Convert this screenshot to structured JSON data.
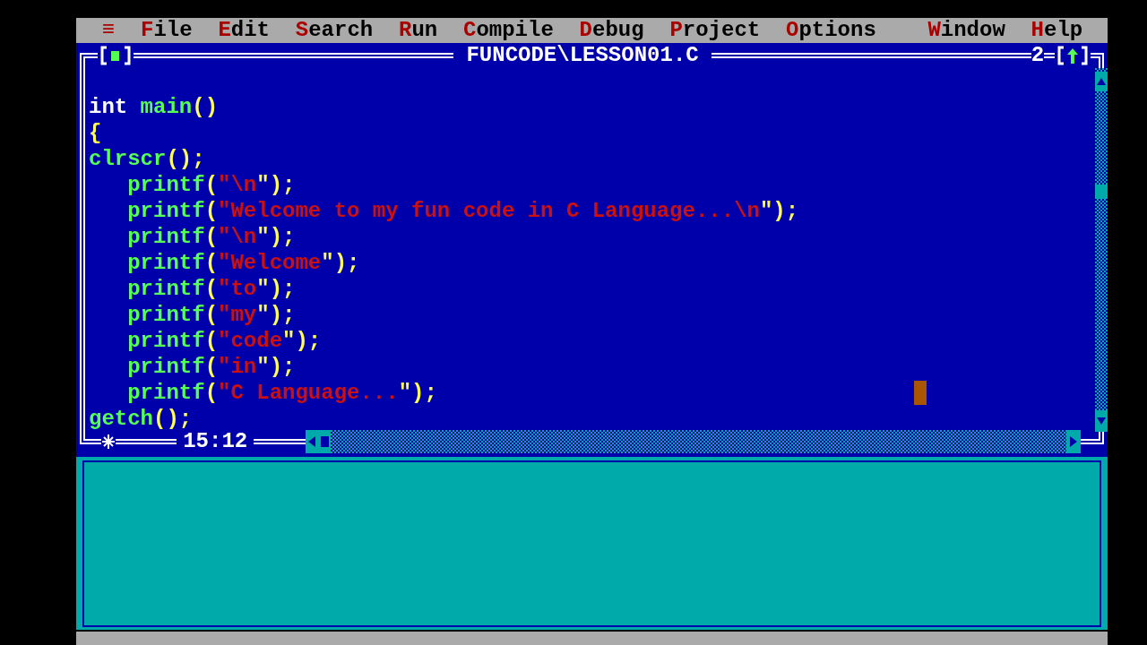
{
  "menu": {
    "left": [
      {
        "label": "≡"
      },
      {
        "label": "File"
      },
      {
        "label": "Edit"
      },
      {
        "label": "Search"
      },
      {
        "label": "Run"
      },
      {
        "label": "Compile"
      },
      {
        "label": "Debug"
      },
      {
        "label": "Project"
      },
      {
        "label": "Options"
      }
    ],
    "right": [
      {
        "label": "Window"
      },
      {
        "label": "Help"
      }
    ]
  },
  "editor": {
    "title": "FUNCODE\\LESSON01.C",
    "window_number": "2",
    "cursor_position": "15:12",
    "lines": [
      {
        "segments": [
          {
            "kind": "keyword",
            "text": "int"
          },
          {
            "kind": "function",
            "text": " main"
          },
          {
            "kind": "punct",
            "text": "()"
          }
        ]
      },
      {
        "segments": [
          {
            "kind": "punct",
            "text": "{"
          }
        ]
      },
      {
        "segments": [
          {
            "kind": "function",
            "text": "clrscr"
          },
          {
            "kind": "punct",
            "text": "();"
          }
        ]
      },
      {
        "segments": [
          {
            "kind": "function",
            "text": "   printf"
          },
          {
            "kind": "punct",
            "text": "("
          },
          {
            "kind": "string",
            "text": "\"\\n"
          },
          {
            "kind": "punct",
            "text": "\");"
          }
        ]
      },
      {
        "segments": [
          {
            "kind": "function",
            "text": "   printf"
          },
          {
            "kind": "punct",
            "text": "("
          },
          {
            "kind": "string",
            "text": "\"Welcome to my fun code in C Language...\\n"
          },
          {
            "kind": "punct",
            "text": "\");"
          }
        ]
      },
      {
        "segments": [
          {
            "kind": "function",
            "text": "   printf"
          },
          {
            "kind": "punct",
            "text": "("
          },
          {
            "kind": "string",
            "text": "\"\\n"
          },
          {
            "kind": "punct",
            "text": "\");"
          }
        ]
      },
      {
        "segments": [
          {
            "kind": "function",
            "text": "   printf"
          },
          {
            "kind": "punct",
            "text": "("
          },
          {
            "kind": "string",
            "text": "\"Welcome"
          },
          {
            "kind": "punct",
            "text": "\");"
          }
        ]
      },
      {
        "segments": [
          {
            "kind": "function",
            "text": "   printf"
          },
          {
            "kind": "punct",
            "text": "("
          },
          {
            "kind": "string",
            "text": "\"to"
          },
          {
            "kind": "punct",
            "text": "\");"
          }
        ]
      },
      {
        "segments": [
          {
            "kind": "function",
            "text": "   printf"
          },
          {
            "kind": "punct",
            "text": "("
          },
          {
            "kind": "string",
            "text": "\"my"
          },
          {
            "kind": "punct",
            "text": "\");"
          }
        ]
      },
      {
        "segments": [
          {
            "kind": "function",
            "text": "   printf"
          },
          {
            "kind": "punct",
            "text": "("
          },
          {
            "kind": "string",
            "text": "\"code"
          },
          {
            "kind": "punct",
            "text": "\");"
          }
        ]
      },
      {
        "segments": [
          {
            "kind": "function",
            "text": "   printf"
          },
          {
            "kind": "punct",
            "text": "("
          },
          {
            "kind": "string",
            "text": "\"in"
          },
          {
            "kind": "punct",
            "text": "\");"
          }
        ]
      },
      {
        "segments": [
          {
            "kind": "function",
            "text": "   printf"
          },
          {
            "kind": "punct",
            "text": "("
          },
          {
            "kind": "string",
            "text": "\"C Language..."
          },
          {
            "kind": "punct",
            "text": "\");"
          }
        ]
      },
      {
        "segments": [
          {
            "kind": "function",
            "text": "getch"
          },
          {
            "kind": "punct",
            "text": "();"
          }
        ]
      }
    ]
  }
}
